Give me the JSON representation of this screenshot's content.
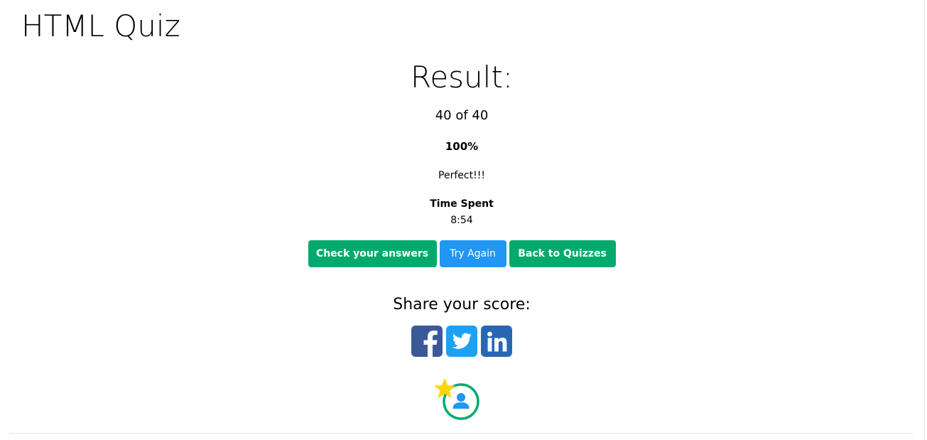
{
  "header": {
    "title": "HTML Quiz"
  },
  "result": {
    "heading": "Result:",
    "score": "40 of 40",
    "percent": "100%",
    "message": "Perfect!!!",
    "time_label": "Time Spent",
    "time_value": "8:54"
  },
  "actions": {
    "check_label": "Check your answers",
    "try_label": "Try Again",
    "back_label": "Back to Quizzes"
  },
  "share": {
    "label": "Share your score:",
    "icons": [
      "facebook-icon",
      "twitter-icon",
      "linkedin-icon"
    ]
  },
  "badge": {
    "icons": [
      "star-icon",
      "user-profile-icon"
    ]
  },
  "colors": {
    "green": "#04aa6d",
    "blue": "#2196f3",
    "facebook": "#3b5998",
    "twitter": "#1da1f2",
    "linkedin": "#2867b2",
    "star": "#ffd600"
  }
}
